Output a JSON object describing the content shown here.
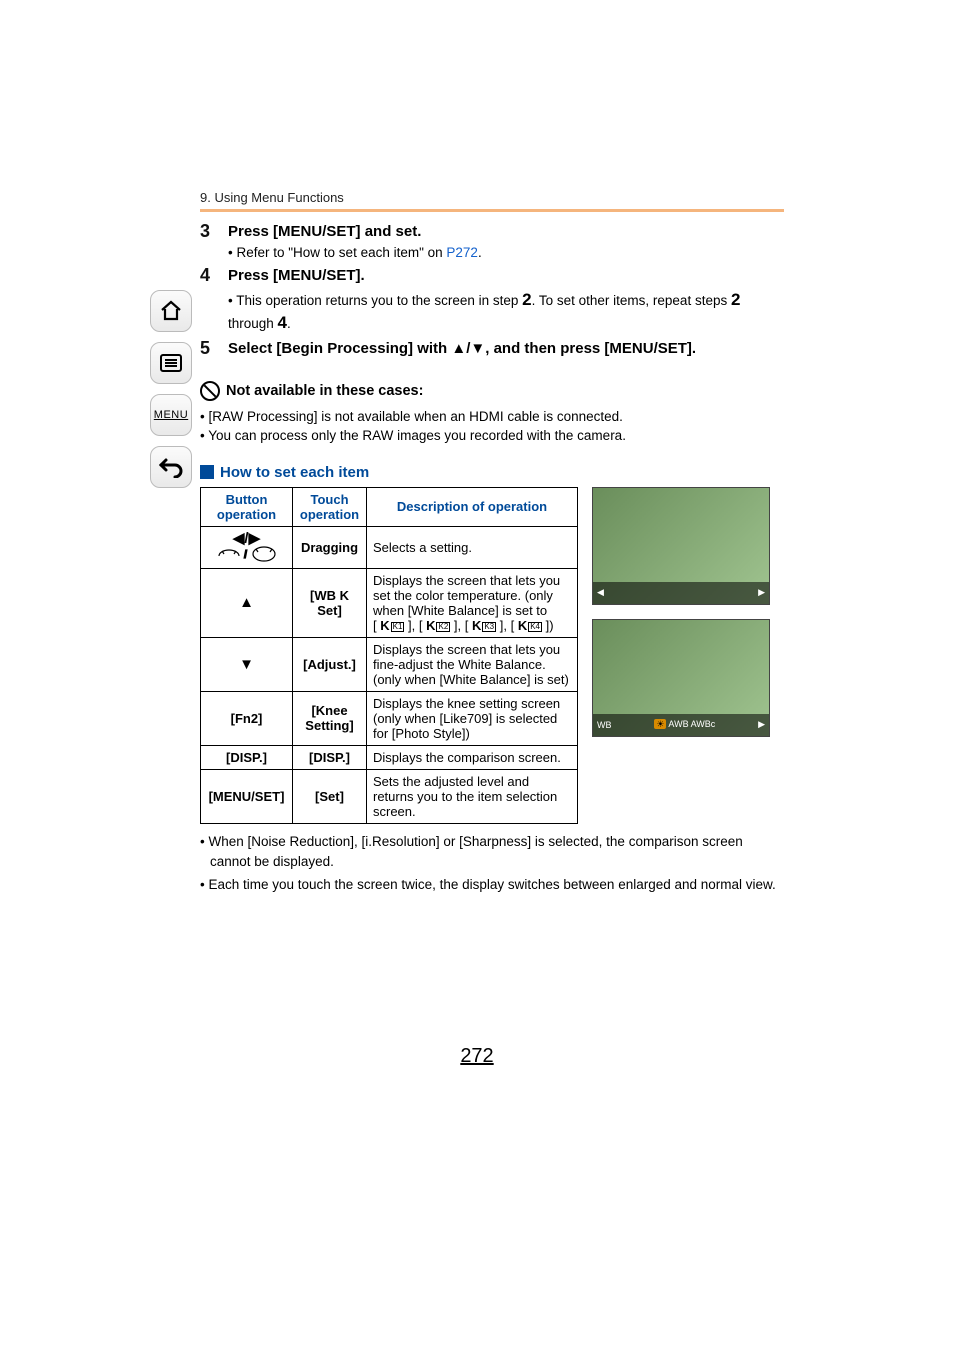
{
  "breadcrumb": "9. Using Menu Functions",
  "sideNav": {
    "menuLabel": "MENU"
  },
  "steps": {
    "s3": {
      "title": "Press [MENU/SET] and set.",
      "sub_prefix": "• Refer to \"How to set each item\" on ",
      "sub_link": "P272",
      "sub_suffix": "."
    },
    "s4": {
      "title": "Press [MENU/SET].",
      "sub_p1": "• This operation returns you to the screen in step ",
      "sub_n1": "2",
      "sub_p2": ". To set other items, repeat steps ",
      "sub_n2": "2",
      "sub_p3": " through ",
      "sub_n3": "4",
      "sub_p4": "."
    },
    "s5": {
      "title": "Select [Begin Processing] with ▲/▼, and then press [MENU/SET]."
    }
  },
  "notAvail": {
    "heading": "Not available in these cases:",
    "b1": "• [RAW Processing] is not available when an HDMI cable is connected.",
    "b2": "• You can process only the RAW images you recorded with the camera."
  },
  "howTo": {
    "heading": "How to set each item"
  },
  "table": {
    "h1": "Button operation",
    "h2": "Touch operation",
    "h3": "Description of operation",
    "r1": {
      "btn": "◀/▶",
      "touch": "Dragging",
      "desc": "Selects a setting."
    },
    "r2": {
      "btn": "▲",
      "touch": "[WB K Set]",
      "desc": "Displays the screen that lets you set the color temperature. (only when [White Balance] is set to "
    },
    "r3": {
      "btn": "▼",
      "touch": "[Adjust.]",
      "desc": "Displays the screen that lets you fine-adjust the White Balance. (only when [White Balance] is set)"
    },
    "r4": {
      "btn": "[Fn2]",
      "touch": "[Knee Setting]",
      "desc": "Displays the knee setting screen (only when [Like709] is selected for [Photo Style])"
    },
    "r5": {
      "btn": "[DISP.]",
      "touch": "[DISP.]",
      "desc": "Displays the comparison screen."
    },
    "r6": {
      "btn": "[MENU/SET]",
      "touch": "[Set]",
      "desc": "Sets the adjusted level and returns you to the item selection screen."
    }
  },
  "wbIcons": {
    "i1": "K1",
    "i2": "K2",
    "i3": "K3",
    "i4": "K4",
    "close": ")"
  },
  "img": {
    "wbLabel": "WB",
    "awb": "AWB",
    "awbc": "AWBc"
  },
  "footNotes": {
    "n1": "• When [Noise Reduction], [i.Resolution] or [Sharpness] is selected, the comparison screen cannot be displayed.",
    "n2": "• Each time you touch the screen twice, the display switches between enlarged and normal view."
  },
  "pageNumber": "272"
}
